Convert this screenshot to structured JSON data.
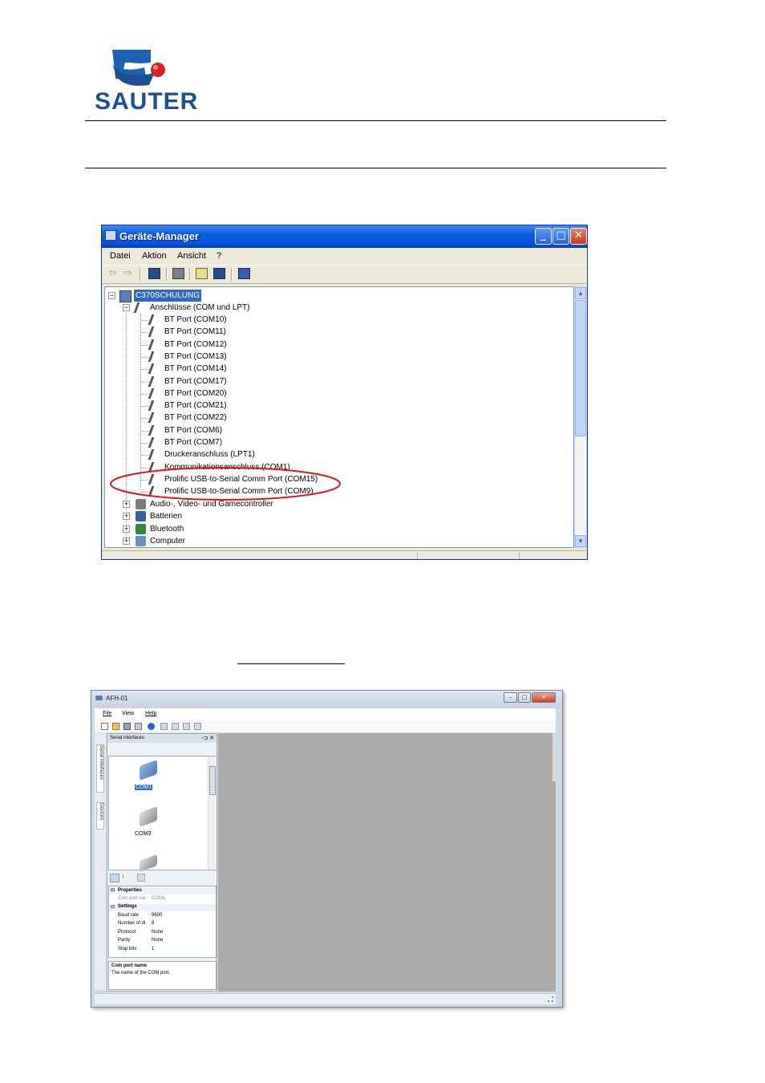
{
  "logo": {
    "name": "SAUTER"
  },
  "device_manager": {
    "title": "Geräte-Manager",
    "menu": [
      "Datei",
      "Aktion",
      "Ansicht",
      "?"
    ],
    "root": "C370SCHULUNG",
    "group": "Anschlüsse (COM und LPT)",
    "ports": [
      "BT Port (COM10)",
      "BT Port (COM11)",
      "BT Port (COM12)",
      "BT Port (COM13)",
      "BT Port (COM14)",
      "BT Port (COM17)",
      "BT Port (COM20)",
      "BT Port (COM21)",
      "BT Port (COM22)",
      "BT Port (COM6)",
      "BT Port (COM7)",
      "Druckeranschluss (LPT1)",
      "Kommunikationsanschluss (COM1)",
      "Prolific USB-to-Serial Comm Port (COM15)",
      "Prolific USB-to-Serial Comm Port (COM9)"
    ],
    "categories": [
      "Audio-, Video- und Gamecontroller",
      "Batterien",
      "Bluetooth",
      "Computer"
    ],
    "highlight_color": "#e0161b",
    "selection_color": "#316ac5",
    "window_controls": {
      "minimize": "_",
      "maximize": "□",
      "close": "✕"
    }
  },
  "afh": {
    "title": "AFH-01",
    "menu": [
      "File",
      "View",
      "Help"
    ],
    "panel_title": "Serial interfaces",
    "side_tabs": [
      "Serial interfaces",
      "Devices"
    ],
    "com_items": [
      "COM1",
      "COM3"
    ],
    "properties": {
      "section1": "Properties",
      "row1_label": "Com port nar",
      "row1_value": "COM1",
      "section2": "Settings",
      "rows": [
        {
          "label": "Baud rate",
          "value": "9600"
        },
        {
          "label": "Number of di",
          "value": "8"
        },
        {
          "label": "Protocol",
          "value": "None"
        },
        {
          "label": "Parity",
          "value": "None"
        },
        {
          "label": "Stop bits",
          "value": "1"
        }
      ]
    },
    "description": {
      "title": "Com port name",
      "text": "The name of the COM port."
    },
    "window_controls": {
      "minimize": "–",
      "maximize": "□",
      "close": "✕"
    },
    "pin_label": "-⊐ ✕"
  }
}
